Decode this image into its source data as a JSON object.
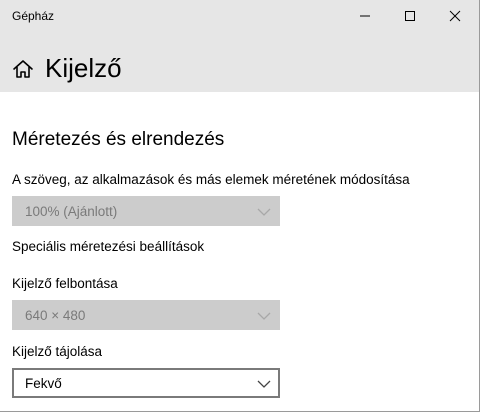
{
  "window": {
    "title": "Gépház",
    "controls": {
      "minimize": "minimize-icon",
      "maximize": "maximize-icon",
      "close": "close-icon"
    }
  },
  "header": {
    "home_icon": "home-icon",
    "title": "Kijelző"
  },
  "main": {
    "section_heading": "Méretezés és elrendezés",
    "scale": {
      "label": "A szöveg, az alkalmazások és más elemek méretének módosítása",
      "value": "100% (Ajánlott)",
      "enabled": false
    },
    "advanced_scaling_link": "Speciális méretezési beállítások",
    "resolution": {
      "label": "Kijelző felbontása",
      "value": "640 × 480",
      "enabled": false
    },
    "orientation": {
      "label": "Kijelző tájolása",
      "value": "Fekvő",
      "enabled": true
    }
  },
  "colors": {
    "titlebar_bg": "#e6e6e6",
    "content_bg": "#ffffff",
    "disabled_field_bg": "#cccccc",
    "disabled_text": "#7a7a7a",
    "field_border": "#7a7a7a"
  }
}
